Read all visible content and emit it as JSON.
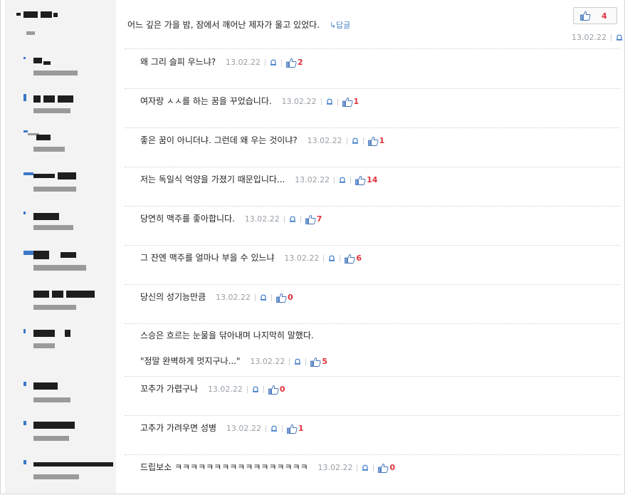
{
  "post": {
    "text": "어느 깊은 가을 밤, 잠에서 깨어난 제자가 울고 있었다.",
    "reply_label": "↳답글",
    "like_count": "4",
    "date": "13.02.22"
  },
  "replies": [
    {
      "text": "왜 그리 슬피 우느냐?",
      "date": "13.02.22",
      "likes": "2"
    },
    {
      "text": "여자랑 ㅅㅅ를 하는 꿈을 꾸었습니다.",
      "date": "13.02.22",
      "likes": "1"
    },
    {
      "text": "좋은 꿈이 아니더냐. 그런데 왜 우는 것이냐?",
      "date": "13.02.22",
      "likes": "1"
    },
    {
      "text": "저는 독일식 억양을 가졌기 때문입니다...",
      "date": "13.02.22",
      "likes": "14"
    },
    {
      "text": "당연히 맥주를 좋아합니다.",
      "date": "13.02.22",
      "likes": "7"
    },
    {
      "text": "그 잔엔 맥주를 얼마나 부을 수 있느냐",
      "date": "13.02.22",
      "likes": "6"
    },
    {
      "text": "당신의 성기능만큼",
      "date": "13.02.22",
      "likes": "0"
    },
    {
      "text": "스승은 흐르는 눈물을 닦아내며 나지막히 말했다.",
      "text2": "\"정말 완벽하게 멋지구나...\"",
      "date": "13.02.22",
      "likes": "5"
    },
    {
      "text": "꼬추가 가렵구나",
      "date": "13.02.22",
      "likes": "0"
    },
    {
      "text": "고추가 가려우면 성병",
      "date": "13.02.22",
      "likes": "1"
    },
    {
      "text": "드립보소 ㅋㅋㅋㅋㅋㅋㅋㅋㅋㅋㅋㅋㅋㅋㅋㅋㅋ",
      "date": "13.02.22",
      "likes": "0"
    }
  ],
  "icons": {
    "bell": "bell-icon",
    "thumb": "thumbs-up-icon"
  },
  "colors": {
    "like_count": "#e0323e",
    "reply_link": "#4a86c8",
    "date": "#9aa0a6",
    "sidebar": "#f3f3f3"
  }
}
